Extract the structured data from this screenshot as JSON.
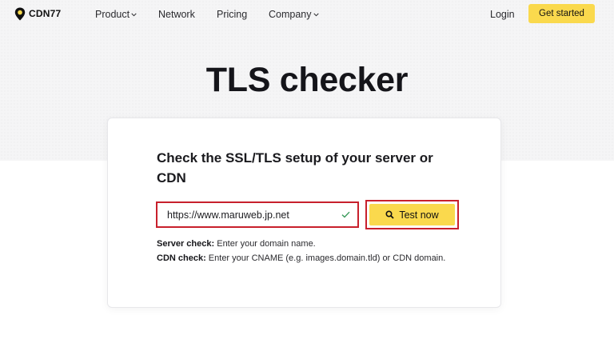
{
  "brand": {
    "name": "CDN77"
  },
  "nav": {
    "items": [
      {
        "label": "Product",
        "has_dropdown": true
      },
      {
        "label": "Network",
        "has_dropdown": false
      },
      {
        "label": "Pricing",
        "has_dropdown": false
      },
      {
        "label": "Company",
        "has_dropdown": true
      }
    ],
    "login_label": "Login",
    "cta_label": "Get started"
  },
  "page": {
    "title": "TLS checker"
  },
  "checker": {
    "heading": "Check the SSL/TLS setup of your server or CDN",
    "input_value": "https://www.maruweb.jp.net",
    "button_label": "Test now",
    "help": {
      "server_label": "Server check:",
      "server_text": " Enter your domain name.",
      "cdn_label": "CDN check:",
      "cdn_text": " Enter your CNAME (e.g. images.domain.tld) or CDN domain."
    }
  },
  "colors": {
    "accent_yellow": "#fad94d",
    "highlight_red": "#c8202c",
    "check_green": "#3a9a5b"
  },
  "icons": {
    "logo": "location-pin-icon",
    "dropdown": "chevron-down-icon",
    "valid": "check-icon",
    "search": "search-icon"
  }
}
